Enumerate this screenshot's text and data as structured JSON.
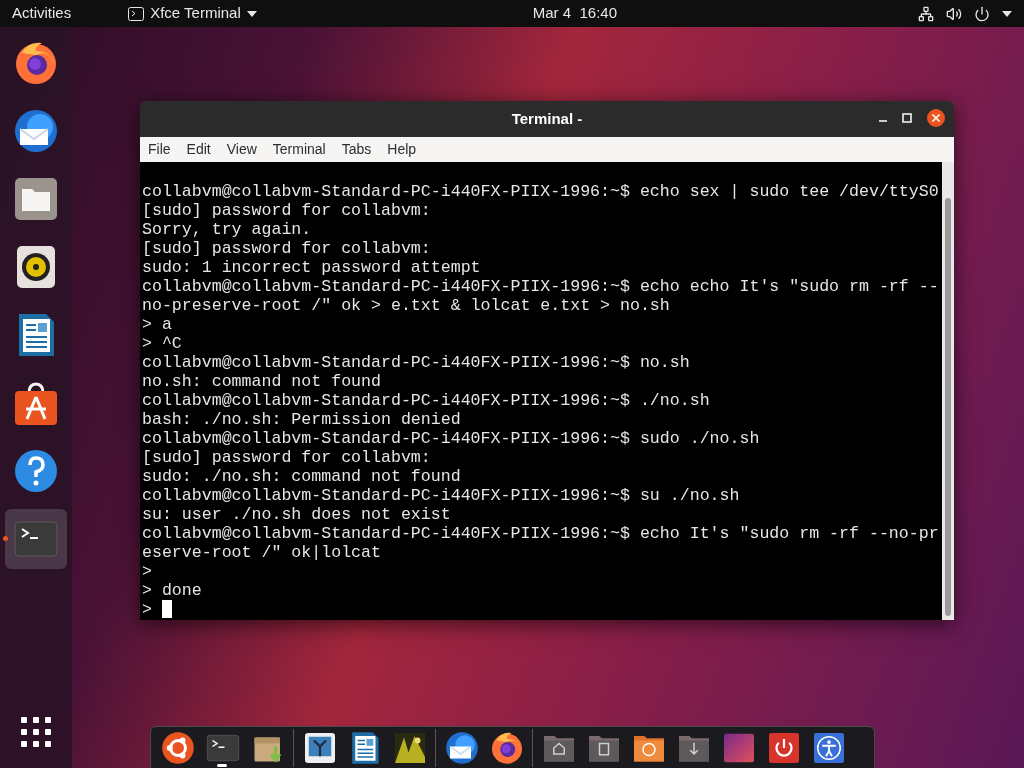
{
  "top_bar": {
    "activities": "Activities",
    "app_menu": "Xfce Terminal",
    "clock": "Mar 4  16:40"
  },
  "left_dock": {
    "apps": [
      {
        "kind": "firefox",
        "running": false,
        "selected": false
      },
      {
        "kind": "thunderbird",
        "running": false,
        "selected": false
      },
      {
        "kind": "files",
        "running": false,
        "selected": false
      },
      {
        "kind": "rhythmbox",
        "running": false,
        "selected": false
      },
      {
        "kind": "writer",
        "running": false,
        "selected": false
      },
      {
        "kind": "software",
        "running": false,
        "selected": false
      },
      {
        "kind": "help",
        "running": false,
        "selected": false
      },
      {
        "kind": "terminal",
        "running": true,
        "selected": true
      }
    ]
  },
  "window": {
    "title": "Terminal -",
    "menu": [
      "File",
      "Edit",
      "View",
      "Terminal",
      "Tabs",
      "Help"
    ],
    "lines": [
      "collabvm@collabvm-Standard-PC-i440FX-PIIX-1996:~$ echo sex | sudo tee /dev/ttyS0",
      "[sudo] password for collabvm:",
      "Sorry, try again.",
      "[sudo] password for collabvm:",
      "sudo: 1 incorrect password attempt",
      "collabvm@collabvm-Standard-PC-i440FX-PIIX-1996:~$ echo echo It's \"sudo rm -rf --",
      "no-preserve-root /\" ok > e.txt & lolcat e.txt > no.sh",
      "> a",
      "> ^C",
      "collabvm@collabvm-Standard-PC-i440FX-PIIX-1996:~$ no.sh",
      "no.sh: command not found",
      "collabvm@collabvm-Standard-PC-i440FX-PIIX-1996:~$ ./no.sh",
      "bash: ./no.sh: Permission denied",
      "collabvm@collabvm-Standard-PC-i440FX-PIIX-1996:~$ sudo ./no.sh",
      "[sudo] password for collabvm:",
      "sudo: ./no.sh: command not found",
      "collabvm@collabvm-Standard-PC-i440FX-PIIX-1996:~$ su ./no.sh",
      "su: user ./no.sh does not exist",
      "collabvm@collabvm-Standard-PC-i440FX-PIIX-1996:~$ echo It's \"sudo rm -rf --no-pr",
      "eserve-root /\" ok|lolcat",
      ">",
      "> done",
      "> "
    ]
  },
  "bottom_dock": {
    "groups": [
      [
        {
          "kind": "ubuntu",
          "running": false
        },
        {
          "kind": "terminal",
          "running": true
        },
        {
          "kind": "archive",
          "running": false
        }
      ],
      [
        {
          "kind": "image-viewer",
          "running": false
        },
        {
          "kind": "writer",
          "running": false
        },
        {
          "kind": "photo",
          "running": false
        }
      ],
      [
        {
          "kind": "thunderbird",
          "running": false
        },
        {
          "kind": "firefox",
          "running": false
        }
      ],
      [
        {
          "kind": "home-folder",
          "running": false
        },
        {
          "kind": "documents-folder",
          "running": false
        },
        {
          "kind": "backup-folder",
          "running": false
        },
        {
          "kind": "downloads-folder",
          "running": false
        },
        {
          "kind": "gradient-app",
          "running": false
        },
        {
          "kind": "power",
          "running": false
        },
        {
          "kind": "accessibility",
          "running": false
        }
      ]
    ]
  }
}
